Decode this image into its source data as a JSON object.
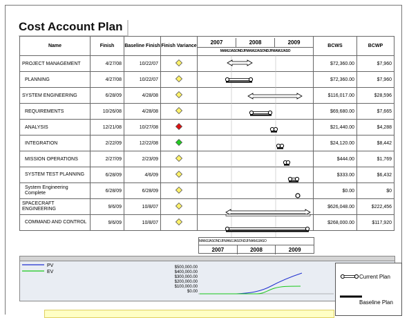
{
  "title": "Cost Account Plan",
  "columns": {
    "name": "Name",
    "finish": "Finish",
    "baseline": "Baseline Finish",
    "variance": "Finish Variance",
    "bcws": "BCWS",
    "bcwp": "BCWP"
  },
  "years": [
    "2007",
    "2008",
    "2009"
  ],
  "month_strip": "MAMJJASONDJFMAMJJASONDJFMAMJJASO",
  "rows": [
    {
      "name": "PROJECT MANAGEMENT",
      "finish": "4/27/08",
      "baseline": "10/22/07",
      "diamond": "yellow",
      "bcws": "$72,360.00",
      "bcwp": "$7,960",
      "indent": false
    },
    {
      "name": "PLANNING",
      "finish": "4/27/08",
      "baseline": "10/22/07",
      "diamond": "yellow",
      "bcws": "$72,360.00",
      "bcwp": "$7,960",
      "indent": true
    },
    {
      "name": "SYSTEM ENGINEERING",
      "finish": "6/28/09",
      "baseline": "4/28/08",
      "diamond": "yellow",
      "bcws": "$116,017.00",
      "bcwp": "$28,596",
      "indent": false
    },
    {
      "name": "REQUIREMENTS",
      "finish": "10/26/08",
      "baseline": "4/28/08",
      "diamond": "yellow",
      "bcws": "$69,680.00",
      "bcwp": "$7,665",
      "indent": true
    },
    {
      "name": "ANALYSIS",
      "finish": "12/21/08",
      "baseline": "10/27/08",
      "diamond": "red",
      "bcws": "$21,440.00",
      "bcwp": "$4,288",
      "indent": true
    },
    {
      "name": "INTEGRATION",
      "finish": "2/22/09",
      "baseline": "12/22/08",
      "diamond": "green",
      "bcws": "$24,120.00",
      "bcwp": "$8,442",
      "indent": true
    },
    {
      "name": "MISSION OPERATIONS",
      "finish": "2/27/09",
      "baseline": "2/23/09",
      "diamond": "yellow",
      "bcws": "$444.00",
      "bcwp": "$1,769",
      "indent": true
    },
    {
      "name": "SYSTEM TEST PLANNING",
      "finish": "6/28/09",
      "baseline": "4/6/09",
      "diamond": "yellow",
      "bcws": "$333.00",
      "bcwp": "$6,432",
      "indent": true
    },
    {
      "name": "System Engineering Complete",
      "finish": "6/28/09",
      "baseline": "6/28/09",
      "diamond": "yellow",
      "bcws": "$0.00",
      "bcwp": "$0",
      "indent": true
    },
    {
      "name": "SPACECRAFT ENGINEERING",
      "finish": "9/6/09",
      "baseline": "10/8/07",
      "diamond": "yellow",
      "bcws": "$626,048.00",
      "bcwp": "$222,456",
      "indent": false
    },
    {
      "name": "COMMAND AND CONTROL",
      "finish": "9/6/09",
      "baseline": "10/8/07",
      "diamond": "yellow",
      "bcws": "$268,000.00",
      "bcwp": "$117,920",
      "indent": true
    }
  ],
  "legend": {
    "pv": "PV",
    "ev": "EV"
  },
  "y_axis": [
    "$500,000.00",
    "$400,000.00",
    "$300,000.00",
    "$200,000.00",
    "$100,000.00",
    "$0.00"
  ],
  "plan_legend": {
    "current": "Current Plan",
    "baseline": "Baseline Plan"
  },
  "colors": {
    "pv": "#1f2fd0",
    "ev": "#18c818",
    "yellow": "#fff26a",
    "red": "#dd1111",
    "green": "#22cc22"
  }
}
